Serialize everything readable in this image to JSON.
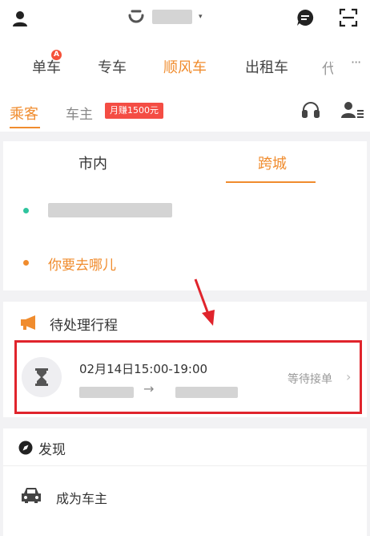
{
  "topbar": {
    "brand_caret": "▾"
  },
  "services": [
    {
      "label": "单车",
      "badge": "A"
    },
    {
      "label": "专车"
    },
    {
      "label": "顺风车",
      "active": true
    },
    {
      "label": "出租车"
    }
  ],
  "services_cut": "代",
  "services_more": "···",
  "role_tabs": {
    "passenger": "乘客",
    "owner": "车主",
    "promo": "月赚1500元"
  },
  "ride_tabs": {
    "local": "市内",
    "intercity": "跨城"
  },
  "route": {
    "destination_placeholder": "你要去哪儿"
  },
  "pending": {
    "title": "待处理行程",
    "trip": {
      "time": "02月14日15:00-19:00",
      "arrow": "→",
      "status": "等待接单",
      "chevron": "›"
    }
  },
  "discover": {
    "title": "发现",
    "item": "成为车主"
  },
  "colors": {
    "accent": "#f08c2e",
    "highlight_border": "#e0242c",
    "promo_bg": "#f44d44",
    "start_dot": "#2fc49e"
  }
}
